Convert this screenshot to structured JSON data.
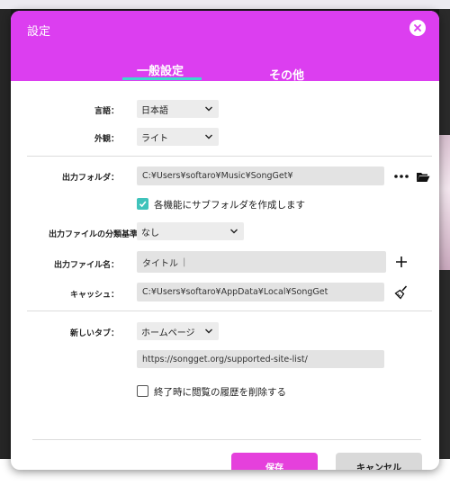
{
  "dialog": {
    "title": "設定",
    "tabs": [
      {
        "label": "一般設定",
        "active": true
      },
      {
        "label": "その他",
        "active": false
      }
    ],
    "accent_color": "#dc3ef0",
    "tab_indicator_color": "#3fd8cf"
  },
  "general": {
    "language": {
      "label": "言語：",
      "value": "日本語"
    },
    "appearance": {
      "label": "外観：",
      "value": "ライト"
    },
    "output_folder": {
      "label": "出力フォルダ：",
      "value": "C:¥Users¥softaro¥Music¥SongGet¥"
    },
    "subfolder": {
      "label": "各機能にサブフォルダを作成します",
      "checked": true
    },
    "classification": {
      "label": "出力ファイルの分類基準：",
      "value": "なし"
    },
    "filename": {
      "label": "出力ファイル名：",
      "value": "タイトル"
    },
    "cache": {
      "label": "キャッシュ：",
      "value": "C:¥Users¥softaro¥AppData¥Local¥SongGet"
    },
    "new_tab": {
      "label": "新しいタブ：",
      "value": "ホームページ"
    },
    "homepage_url": "https://songget.org/supported-site-list/",
    "clear_history": {
      "label": "終了時に閲覧の履歴を削除する",
      "checked": false
    }
  },
  "footer": {
    "save_label": "保存",
    "cancel_label": "キャンセル",
    "save_color": "#e540dc"
  },
  "icons": {
    "close": "close-icon",
    "more": "more-dots-icon",
    "folder": "folder-open-icon",
    "add": "plus-icon",
    "broom": "broom-icon",
    "chevron": "chevron-down-icon",
    "check": "check-icon"
  }
}
